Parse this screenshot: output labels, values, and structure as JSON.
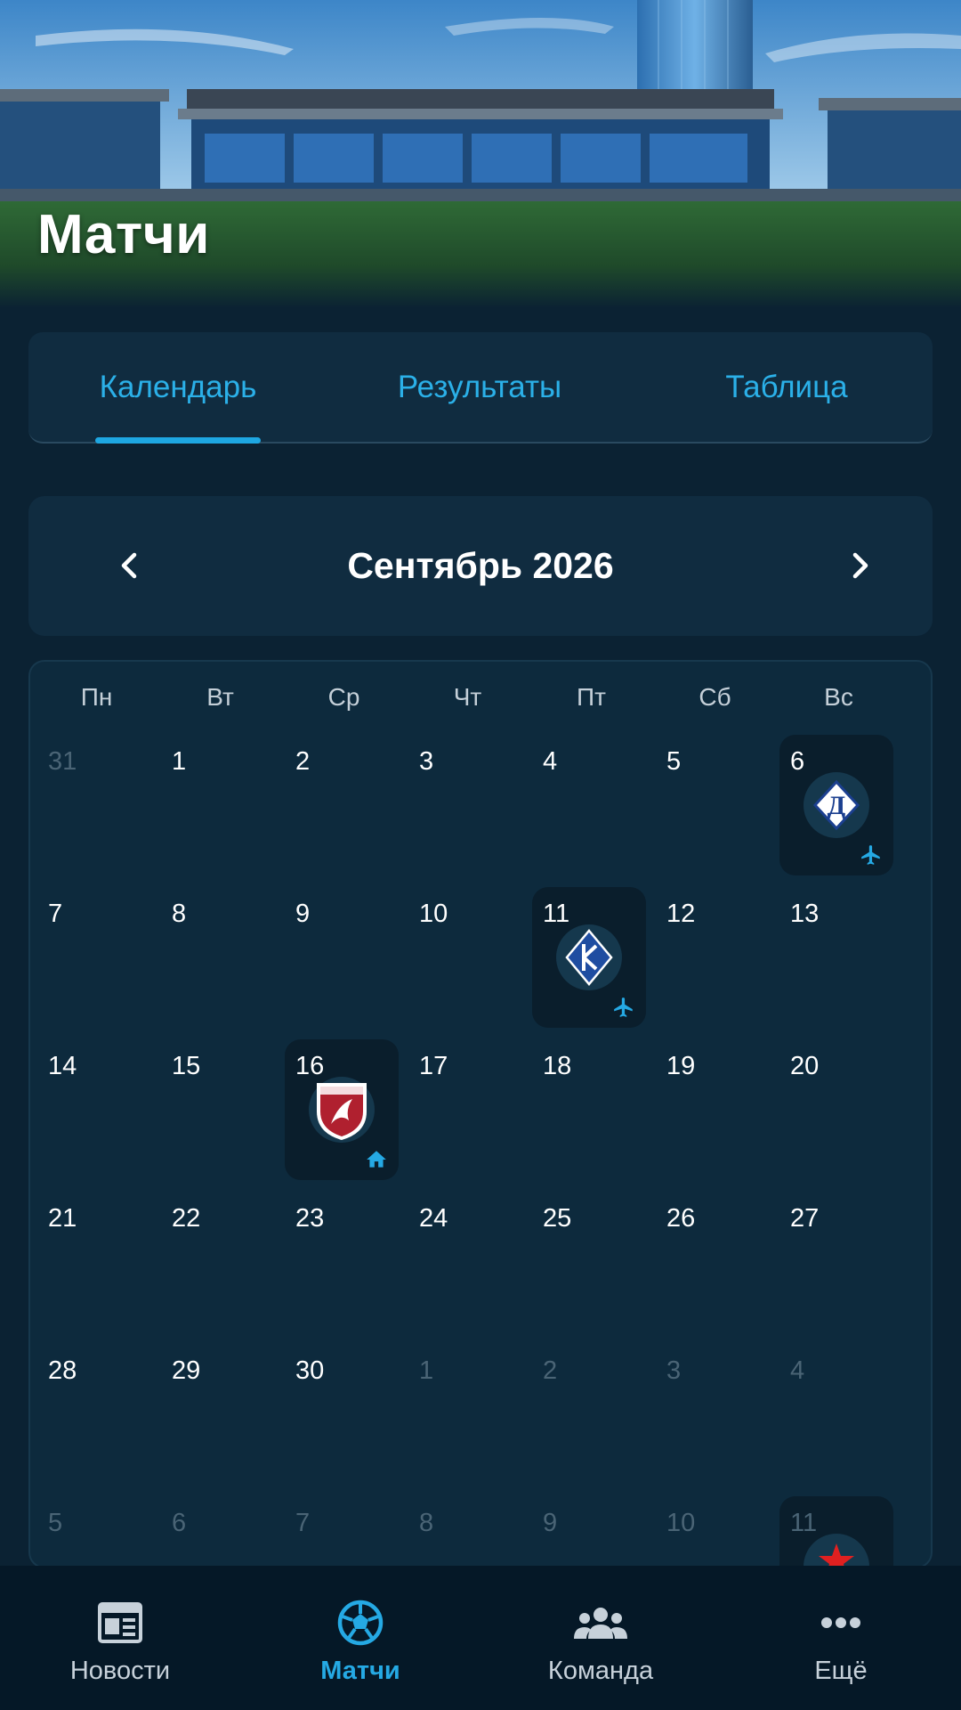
{
  "header": {
    "title": "Матчи"
  },
  "tabs": [
    {
      "label": "Календарь",
      "active": true
    },
    {
      "label": "Результаты",
      "active": false
    },
    {
      "label": "Таблица",
      "active": false
    }
  ],
  "month": {
    "label": "Сентябрь 2026",
    "prev_icon": "chevron-left-icon",
    "next_icon": "chevron-right-icon"
  },
  "weekdays": [
    "Пн",
    "Вт",
    "Ср",
    "Чт",
    "Пт",
    "Сб",
    "Вс"
  ],
  "days": [
    {
      "n": "31",
      "muted": true
    },
    {
      "n": "1"
    },
    {
      "n": "2"
    },
    {
      "n": "3"
    },
    {
      "n": "4"
    },
    {
      "n": "5"
    },
    {
      "n": "6",
      "match": {
        "crest": "dinamo-crest",
        "venue": "away"
      }
    },
    {
      "n": "7"
    },
    {
      "n": "8"
    },
    {
      "n": "9"
    },
    {
      "n": "10"
    },
    {
      "n": "11",
      "match": {
        "crest": "krylia-crest",
        "venue": "away"
      }
    },
    {
      "n": "12"
    },
    {
      "n": "13"
    },
    {
      "n": "14"
    },
    {
      "n": "15"
    },
    {
      "n": "16",
      "match": {
        "crest": "rubin-crest",
        "venue": "home"
      }
    },
    {
      "n": "17"
    },
    {
      "n": "18"
    },
    {
      "n": "19"
    },
    {
      "n": "20"
    },
    {
      "n": "21"
    },
    {
      "n": "22"
    },
    {
      "n": "23"
    },
    {
      "n": "24"
    },
    {
      "n": "25"
    },
    {
      "n": "26"
    },
    {
      "n": "27"
    },
    {
      "n": "28"
    },
    {
      "n": "29"
    },
    {
      "n": "30"
    },
    {
      "n": "1",
      "muted": true
    },
    {
      "n": "2",
      "muted": true
    },
    {
      "n": "3",
      "muted": true
    },
    {
      "n": "4",
      "muted": true
    },
    {
      "n": "5",
      "muted": true
    },
    {
      "n": "6",
      "muted": true
    },
    {
      "n": "7",
      "muted": true
    },
    {
      "n": "8",
      "muted": true
    },
    {
      "n": "9",
      "muted": true
    },
    {
      "n": "10",
      "muted": true
    },
    {
      "n": "11",
      "muted": true,
      "match": {
        "crest": "cska-crest",
        "venue": "unknown"
      }
    }
  ],
  "venue_icons": {
    "away": "airplane-icon",
    "home": "home-icon"
  },
  "bottom_nav": [
    {
      "label": "Новости",
      "icon": "newspaper-icon",
      "active": false
    },
    {
      "label": "Матчи",
      "icon": "soccer-ball-icon",
      "active": true
    },
    {
      "label": "Команда",
      "icon": "team-icon",
      "active": false
    },
    {
      "label": "Ещё",
      "icon": "more-dots-icon",
      "active": false
    }
  ],
  "colors": {
    "background": "#0b2233",
    "panel": "#102c40",
    "accent": "#1ea7e2",
    "muted_text": "#4a6475",
    "nav_background": "#051827"
  }
}
